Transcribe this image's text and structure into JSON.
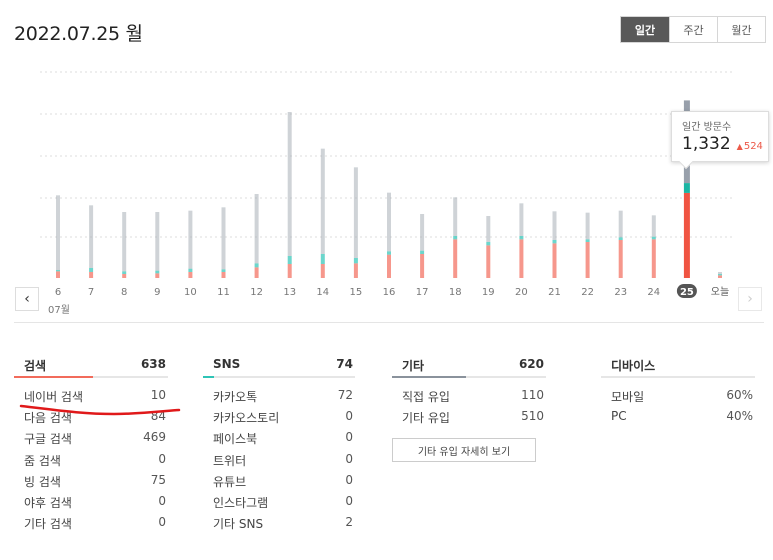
{
  "date_title": "2022.07.25 월",
  "period_tabs": [
    {
      "label": "일간",
      "active": true
    },
    {
      "label": "주간",
      "active": false
    },
    {
      "label": "월간",
      "active": false
    }
  ],
  "month_label": "07월",
  "colors": {
    "search": "#f26b5b",
    "sns": "#2ec4b6",
    "other": "#a7aeb7",
    "highlight_other": "#98a0ab",
    "highlight_search": "#f05442",
    "highlight_sns": "#1bb5a3",
    "day_label_selected_bg": "#555555"
  },
  "tooltip": {
    "title": "일간 방문수",
    "value": "1,332",
    "delta_arrow": "▲",
    "delta": "524"
  },
  "chart_data": {
    "type": "bar",
    "stacked": true,
    "categories": [
      "6",
      "7",
      "8",
      "9",
      "10",
      "11",
      "12",
      "13",
      "14",
      "15",
      "16",
      "17",
      "18",
      "19",
      "20",
      "21",
      "22",
      "23",
      "24",
      "25",
      "오늘"
    ],
    "selected": "25",
    "series": [
      {
        "name": "검색",
        "values": [
          50,
          45,
          30,
          35,
          45,
          45,
          80,
          105,
          105,
          110,
          175,
          180,
          290,
          245,
          290,
          260,
          270,
          285,
          290,
          638,
          20
        ]
      },
      {
        "name": "SNS",
        "values": [
          10,
          30,
          20,
          20,
          25,
          20,
          30,
          60,
          75,
          40,
          25,
          25,
          25,
          25,
          25,
          25,
          20,
          20,
          20,
          74,
          10
        ]
      },
      {
        "name": "기타",
        "values": [
          560,
          470,
          445,
          440,
          435,
          465,
          520,
          1080,
          790,
          680,
          440,
          275,
          290,
          195,
          245,
          215,
          200,
          200,
          160,
          620,
          15
        ]
      }
    ],
    "ylim": [
      0,
      1500
    ]
  },
  "sections": [
    {
      "title": "검색",
      "total": "638",
      "bar_color": "#f26b5b",
      "bar_fraction": 0.51,
      "rows": [
        {
          "label": "네이버 검색",
          "value": "10"
        },
        {
          "label": "다음 검색",
          "value": "84"
        },
        {
          "label": "구글 검색",
          "value": "469"
        },
        {
          "label": "줌 검색",
          "value": "0"
        },
        {
          "label": "빙 검색",
          "value": "75"
        },
        {
          "label": "야후 검색",
          "value": "0"
        },
        {
          "label": "기타 검색",
          "value": "0"
        }
      ]
    },
    {
      "title": "SNS",
      "total": "74",
      "bar_color": "#2ec4b6",
      "bar_fraction": 0.07,
      "rows": [
        {
          "label": "카카오톡",
          "value": "72"
        },
        {
          "label": "카카오스토리",
          "value": "0"
        },
        {
          "label": "페이스북",
          "value": "0"
        },
        {
          "label": "트위터",
          "value": "0"
        },
        {
          "label": "유튜브",
          "value": "0"
        },
        {
          "label": "인스타그램",
          "value": "0"
        },
        {
          "label": "기타 SNS",
          "value": "2"
        }
      ]
    },
    {
      "title": "기타",
      "total": "620",
      "bar_color": "#8a929c",
      "bar_fraction": 0.48,
      "rows": [
        {
          "label": "직접 유입",
          "value": "110"
        },
        {
          "label": "기타 유입",
          "value": "510"
        }
      ],
      "button": "기타 유입 자세히 보기"
    },
    {
      "title": "디바이스",
      "total": "",
      "bar_color": "#e6e6e6",
      "bar_fraction": 0,
      "rows": [
        {
          "label": "모바일",
          "value": "60%"
        },
        {
          "label": "PC",
          "value": "40%"
        }
      ]
    }
  ]
}
